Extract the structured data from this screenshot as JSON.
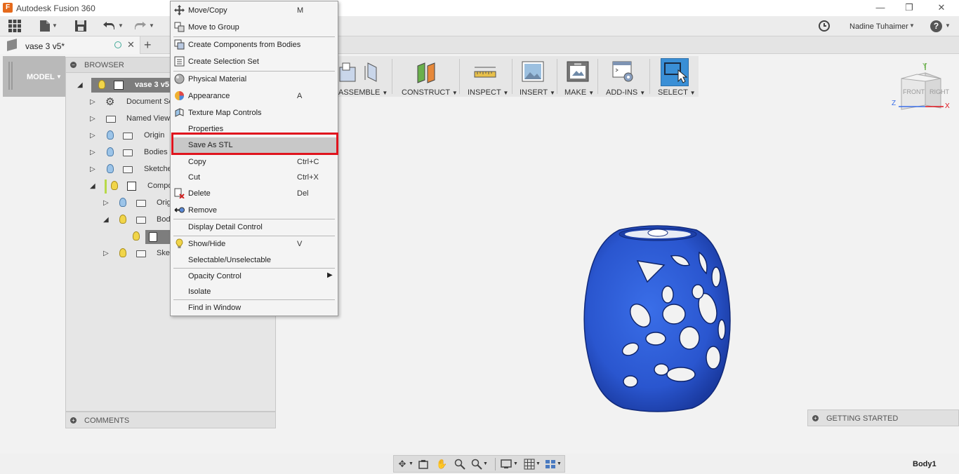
{
  "window": {
    "title": "Autodesk Fusion 360",
    "logo_letter": "F",
    "minimize": "—",
    "restore": "❐",
    "close": "✕"
  },
  "toolbar": {
    "user_name": "Nadine Tuhaimer",
    "user_caret": "▼",
    "help": "?",
    "help_caret": "▼",
    "icons": [
      "apps-grid-icon",
      "file-icon",
      "save-icon",
      "undo-icon",
      "redo-icon",
      "history-icon",
      "help-icon"
    ]
  },
  "tabs": {
    "document": "vase 3 v5*",
    "close": "✕",
    "new_tab": "+"
  },
  "workspace": {
    "label": "MODEL",
    "caret": "▼"
  },
  "ribbon": {
    "groups": [
      {
        "label": "ASSEMBLE",
        "caret": "▼"
      },
      {
        "label": "CONSTRUCT",
        "caret": "▼"
      },
      {
        "label": "INSPECT",
        "caret": "▼"
      },
      {
        "label": "INSERT",
        "caret": "▼"
      },
      {
        "label": "MAKE",
        "caret": "▼"
      },
      {
        "label": "ADD-INS",
        "caret": "▼"
      },
      {
        "label": "SELECT",
        "caret": "▼"
      }
    ]
  },
  "browser": {
    "title": "BROWSER",
    "collapse": "−",
    "root": "vase 3 v5",
    "rows": [
      {
        "label": "Document Se",
        "tri": "▷"
      },
      {
        "label": "Named View",
        "tri": "▷"
      },
      {
        "label": "Origin",
        "tri": "▷"
      },
      {
        "label": "Bodies",
        "tri": "▷"
      },
      {
        "label": "Sketche",
        "tri": "▷"
      },
      {
        "label": "Compo",
        "tri": "◢"
      },
      {
        "label": "Origi",
        "tri": "▷"
      },
      {
        "label": "Bod",
        "tri": "◢"
      },
      {
        "label": "",
        "tri": ""
      },
      {
        "label": "Sket",
        "tri": "▷"
      }
    ],
    "root_tri": "◢"
  },
  "comments": {
    "label": "COMMENTS",
    "plus": "+"
  },
  "getting_started": {
    "label": "GETTING STARTED",
    "plus": "+"
  },
  "viewcube": {
    "front": "FRONT",
    "right": "RIGHT",
    "x": "X",
    "y": "Y",
    "z": "Z"
  },
  "status": {
    "selection": "Body1"
  },
  "context_menu": {
    "items": [
      {
        "label": "Move/Copy",
        "shortcut": "M",
        "icon": "move-icon"
      },
      {
        "label": "Move to Group",
        "shortcut": "",
        "icon": "move-group-icon"
      },
      {
        "label": "Create Components from Bodies",
        "shortcut": "",
        "icon": "components-icon"
      },
      {
        "label": "Create Selection Set",
        "shortcut": "",
        "icon": "selection-set-icon"
      },
      {
        "label": "Physical Material",
        "shortcut": "",
        "icon": "material-icon"
      },
      {
        "label": "Appearance",
        "shortcut": "A",
        "icon": "appearance-icon"
      },
      {
        "label": "Texture Map Controls",
        "shortcut": "",
        "icon": "texture-icon"
      },
      {
        "label": "Properties",
        "shortcut": "",
        "icon": ""
      },
      {
        "label": "Save As STL",
        "shortcut": "",
        "icon": ""
      },
      {
        "label": "Copy",
        "shortcut": "Ctrl+C",
        "icon": ""
      },
      {
        "label": "Cut",
        "shortcut": "Ctrl+X",
        "icon": ""
      },
      {
        "label": "Delete",
        "shortcut": "Del",
        "icon": "delete-icon"
      },
      {
        "label": "Remove",
        "shortcut": "",
        "icon": "remove-icon"
      },
      {
        "label": "Display Detail Control",
        "shortcut": "",
        "icon": ""
      },
      {
        "label": "Show/Hide",
        "shortcut": "V",
        "icon": "bulb-icon"
      },
      {
        "label": "Selectable/Unselectable",
        "shortcut": "",
        "icon": ""
      },
      {
        "label": "Opacity Control",
        "shortcut": "▶",
        "icon": ""
      },
      {
        "label": "Isolate",
        "shortcut": "",
        "icon": ""
      },
      {
        "label": "Find in Window",
        "shortcut": "",
        "icon": ""
      }
    ]
  },
  "colors": {
    "vase": "#2f5fd8",
    "vase_dark": "#1d3fa8",
    "highlight": "#e0141e",
    "bulb": "#f1d54a",
    "bulb_off": "#9cc4e8"
  }
}
